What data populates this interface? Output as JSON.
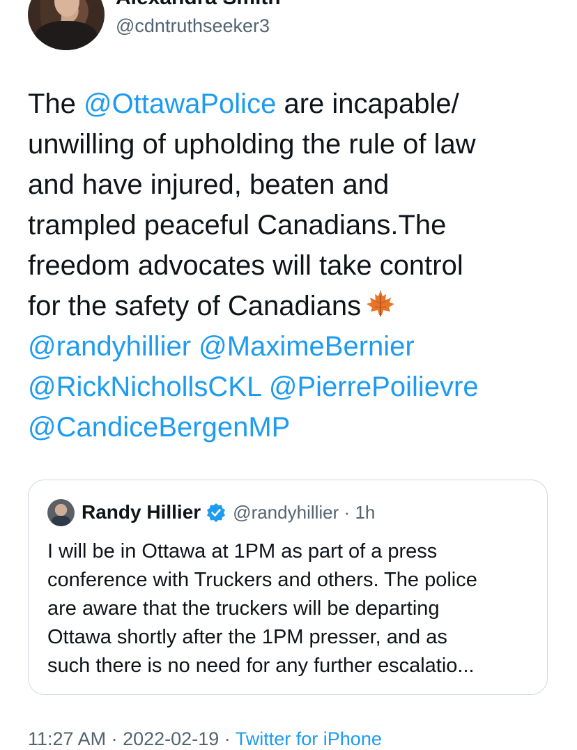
{
  "author": {
    "display_name": "Alexandra Smith",
    "handle": "@cdntruthseeker3"
  },
  "tweet": {
    "lines": [
      [
        "The ",
        "@OttawaPolice",
        " are incapable/"
      ],
      [
        "unwilling of upholding the rule of law"
      ],
      [
        "and have injured, beaten and"
      ],
      [
        "trampled peaceful Canadians.The"
      ],
      [
        "freedom advocates will take control"
      ],
      [
        "for the safety of Canadians"
      ]
    ],
    "emoji": "maple-leaf-icon",
    "mentions": [
      "@randyhillier",
      "@MaximeBernier",
      "@RickNichollsCKL",
      "@PierrePoilievre",
      "@CandiceBergenMP"
    ]
  },
  "quoted_tweet": {
    "display_name": "Randy Hillier",
    "handle": "@randyhillier",
    "separator": "·",
    "time": "1h",
    "verified": true,
    "lines": [
      "I will be in Ottawa at 1PM as part of a press",
      "conference with Truckers and others. The police",
      "are aware that the truckers will be departing",
      "Ottawa shortly after the 1PM presser, and as",
      "such there is no need for any further escalatio..."
    ]
  },
  "footer": {
    "time": "11:27 AM",
    "separator": "·",
    "date": "2022-02-19",
    "source": "Twitter for iPhone"
  },
  "colors": {
    "mention": "#1d9bf0",
    "text": "#0f1419",
    "secondary": "#536471",
    "border": "#cfd9de"
  }
}
